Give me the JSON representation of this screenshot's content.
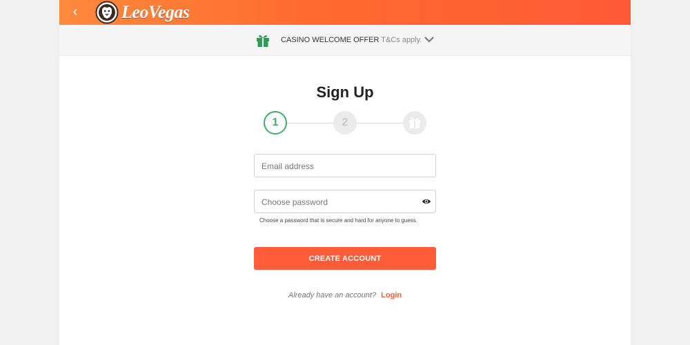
{
  "header": {
    "back_label": "‹",
    "brand": "LeoVegas"
  },
  "offer": {
    "title": "CASINO WELCOME OFFER",
    "terms": "T&Cs apply."
  },
  "signup": {
    "title": "Sign Up",
    "steps": [
      {
        "label": "1",
        "state": "active"
      },
      {
        "label": "2",
        "state": "inactive"
      },
      {
        "label": "",
        "state": "inactive"
      }
    ],
    "email": {
      "placeholder": "Email address",
      "value": ""
    },
    "password": {
      "placeholder": "Choose password",
      "value": ""
    },
    "password_hint": "Choose a password that is secure and hard for anyone to guess.",
    "create_button": "CREATE ACCOUNT",
    "login_prompt": "Already have an account?",
    "login_link": "Login"
  },
  "colors": {
    "brand_orange": "#ff6a2e",
    "cta": "#ff5c3a",
    "step_active": "#3fae6c",
    "gift_green": "#2e9b57"
  },
  "icons": {
    "back": "chevron-left-icon",
    "logo": "lion-logo-icon",
    "gift": "gift-icon",
    "expand": "chevron-down-icon",
    "step_gift": "gift-icon",
    "reveal": "eye-icon"
  }
}
